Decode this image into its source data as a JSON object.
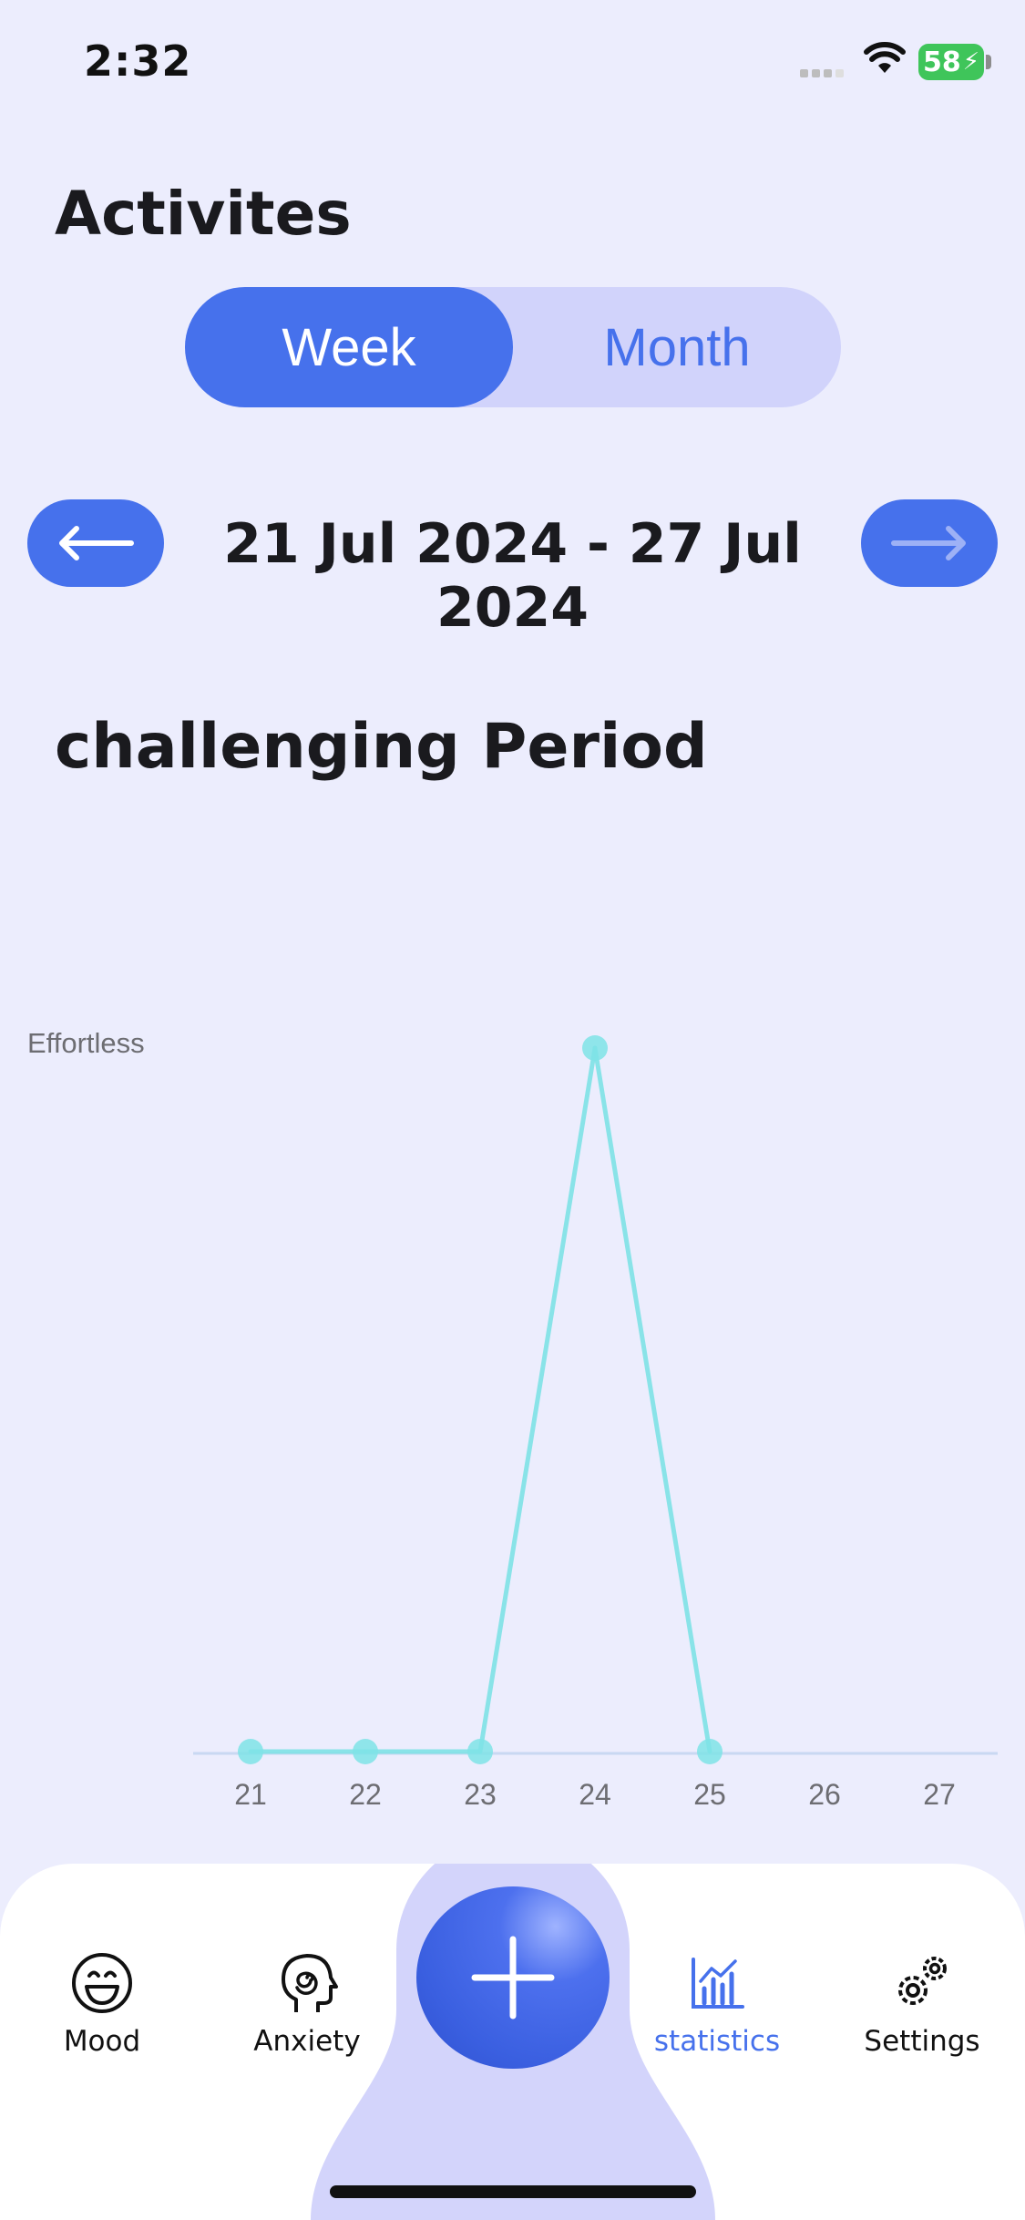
{
  "status_bar": {
    "time": "2:32",
    "battery": "58"
  },
  "header": {
    "title": "Activites"
  },
  "period_toggle": {
    "week_label": "Week",
    "month_label": "Month",
    "selected": "Week"
  },
  "date_nav": {
    "range": "21 Jul 2024 - 27 Jul 2024"
  },
  "section": {
    "title": "challenging Period"
  },
  "chart_data": {
    "type": "line",
    "categories": [
      "21",
      "22",
      "23",
      "24",
      "25",
      "26",
      "27"
    ],
    "values": [
      0,
      0,
      0,
      1,
      0,
      null,
      null
    ],
    "ylabel_top": "Effortless",
    "ylim": [
      0,
      1
    ],
    "line_color": "#7FE3E6",
    "grid": false
  },
  "tabbar": {
    "items": [
      {
        "label": "Mood",
        "icon": "smile-icon"
      },
      {
        "label": "Anxiety",
        "icon": "head-spiral-icon"
      },
      {
        "label": "statistics",
        "icon": "bar-chart-icon",
        "active": true
      },
      {
        "label": "Settings",
        "icon": "gears-icon"
      }
    ],
    "add_icon": "plus-icon"
  },
  "colors": {
    "accent": "#4671EC",
    "background": "#ECEDFD",
    "toggle_bg": "#D1D3FB",
    "line": "#7FE3E6"
  }
}
